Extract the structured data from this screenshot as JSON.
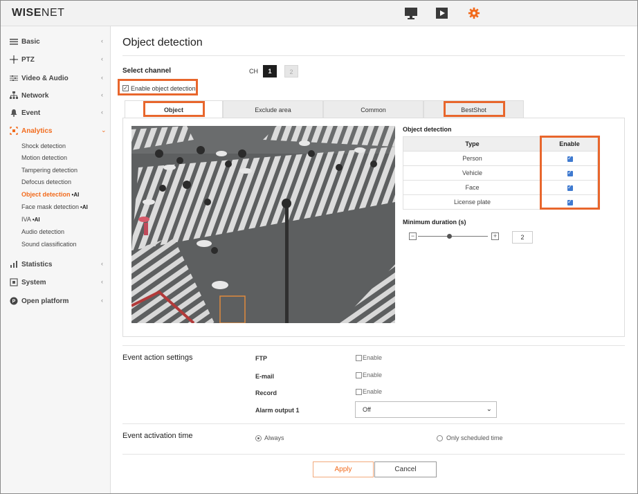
{
  "header": {
    "logo_bold": "WISE",
    "logo_light": "NET",
    "icons": [
      "monitor-icon",
      "play-icon",
      "gear-icon"
    ],
    "accent_color": "#f26b1d"
  },
  "sidebar": {
    "items": [
      {
        "label": "Basic",
        "icon": "list-icon"
      },
      {
        "label": "PTZ",
        "icon": "ptz-icon"
      },
      {
        "label": "Video & Audio",
        "icon": "sliders-icon"
      },
      {
        "label": "Network",
        "icon": "network-icon"
      },
      {
        "label": "Event",
        "icon": "bell-icon"
      },
      {
        "label": "Analytics",
        "icon": "analytics-icon"
      },
      {
        "label": "Statistics",
        "icon": "bar-chart-icon"
      },
      {
        "label": "System",
        "icon": "system-icon"
      },
      {
        "label": "Open platform",
        "icon": "open-platform-icon"
      }
    ],
    "analytics_sub": [
      {
        "label": "Shock detection",
        "ai": ""
      },
      {
        "label": "Motion detection",
        "ai": ""
      },
      {
        "label": "Tampering detection",
        "ai": ""
      },
      {
        "label": "Defocus detection",
        "ai": ""
      },
      {
        "label": "Object detection",
        "ai": "•AI"
      },
      {
        "label": "Face mask detection",
        "ai": "•AI"
      },
      {
        "label": "IVA",
        "ai": "•AI"
      },
      {
        "label": "Audio detection",
        "ai": ""
      },
      {
        "label": "Sound classification",
        "ai": ""
      }
    ]
  },
  "main": {
    "title": "Object detection",
    "select_channel_label": "Select channel",
    "ch_label": "CH",
    "channels": [
      "1",
      "2"
    ],
    "enable_label": "Enable object detection",
    "tabs": [
      "Object",
      "Exclude area",
      "Common",
      "BestShot"
    ],
    "od_section_label": "Object detection",
    "table": {
      "headers": [
        "Type",
        "Enable"
      ],
      "rows": [
        {
          "type": "Person",
          "enabled": true
        },
        {
          "type": "Vehicle",
          "enabled": true
        },
        {
          "type": "Face",
          "enabled": true
        },
        {
          "type": "License plate",
          "enabled": true
        }
      ]
    },
    "min_duration_label": "Minimum duration (s)",
    "min_duration_value": "2",
    "minus": "−",
    "plus": "+"
  },
  "event_action": {
    "label": "Event action settings",
    "rows": [
      {
        "name": "FTP",
        "option": "Enable"
      },
      {
        "name": "E-mail",
        "option": "Enable"
      },
      {
        "name": "Record",
        "option": "Enable"
      }
    ],
    "alarm_label": "Alarm output 1",
    "alarm_value": "Off"
  },
  "activation": {
    "label": "Event activation time",
    "always": "Always",
    "scheduled": "Only scheduled time"
  },
  "buttons": {
    "apply": "Apply",
    "cancel": "Cancel"
  }
}
